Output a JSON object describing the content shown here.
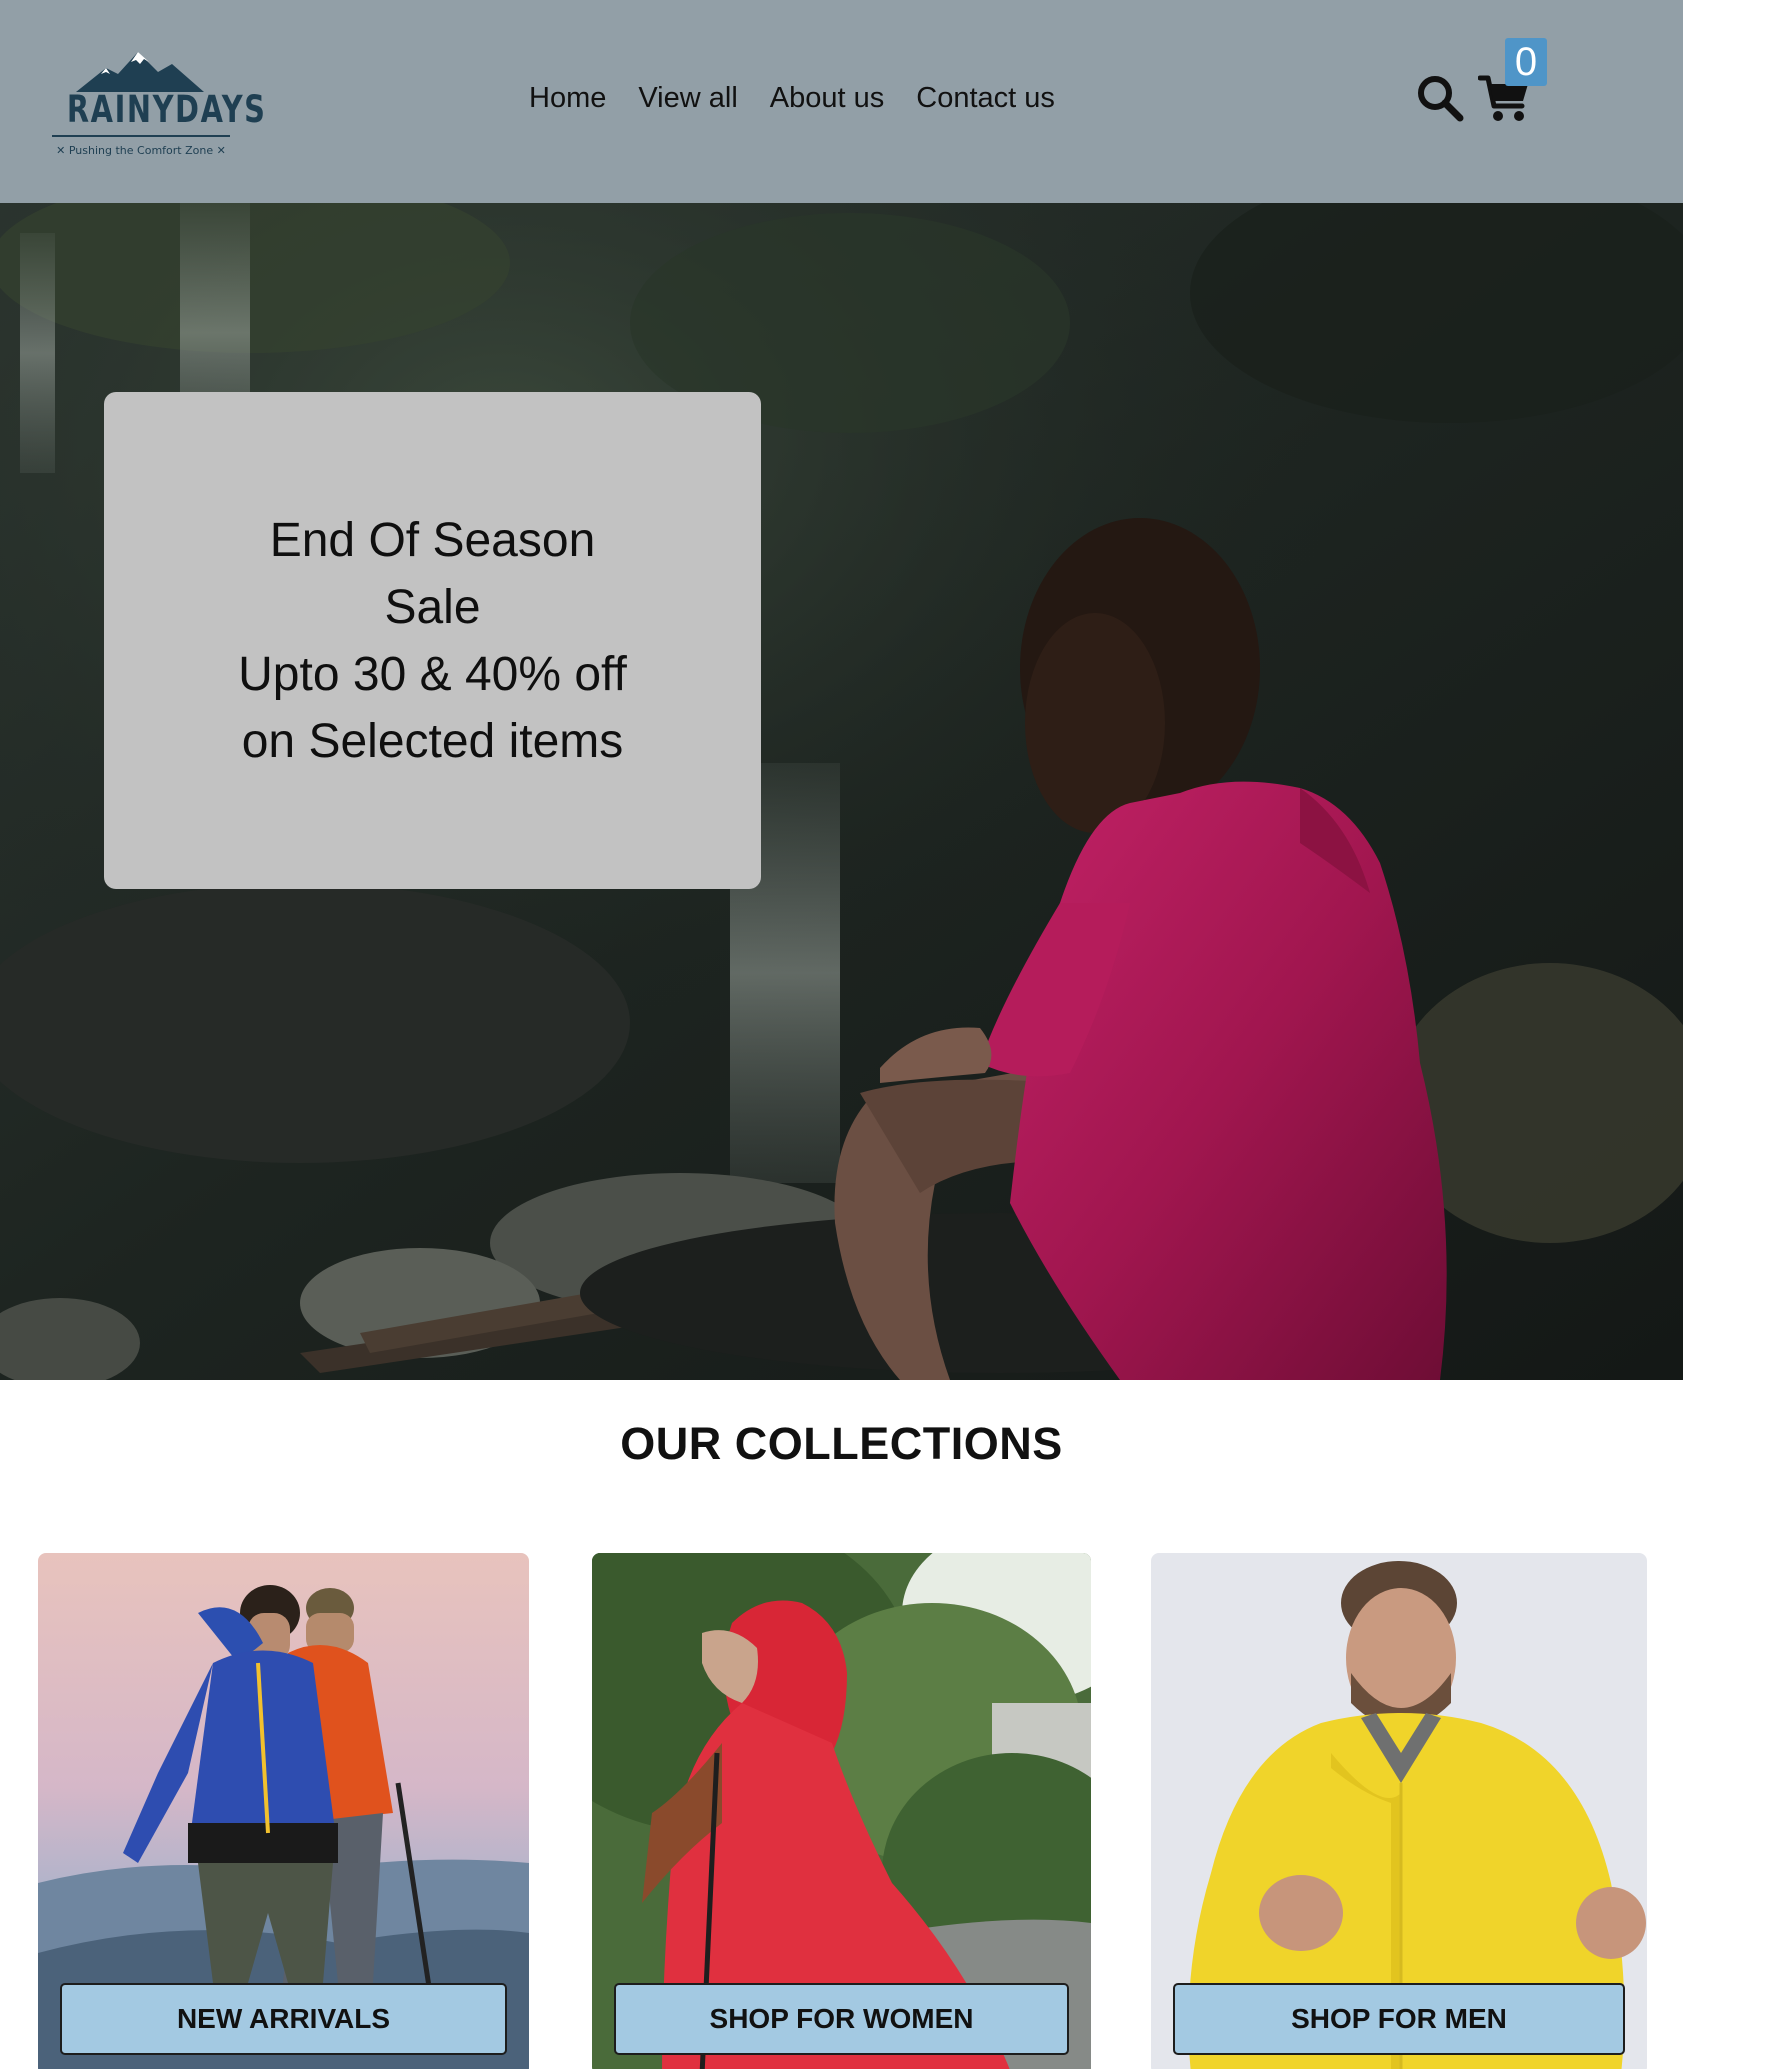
{
  "brand": {
    "name": "RAINYDAYS",
    "tagline": "✕ Pushing the Comfort Zone ✕",
    "color": "#1f3f52"
  },
  "header": {
    "background": "#929fa7",
    "nav": [
      "Home",
      "View all",
      "About us",
      "Contact us"
    ],
    "icons": [
      "search-icon",
      "cart-icon"
    ],
    "cart_count": "0",
    "badge_color": "#4f95c8"
  },
  "hero": {
    "line1": "End Of Season",
    "line2": "Sale",
    "line3": "Upto 30 & 40% off",
    "line4": "on Selected items",
    "box_color": "#c2c2c2"
  },
  "collections": {
    "title": "OUR COLLECTIONS",
    "cards": [
      {
        "label": "NEW ARRIVALS"
      },
      {
        "label": "SHOP FOR WOMEN"
      },
      {
        "label": "SHOP FOR MEN"
      }
    ],
    "button_color": "#a3c9e2"
  }
}
